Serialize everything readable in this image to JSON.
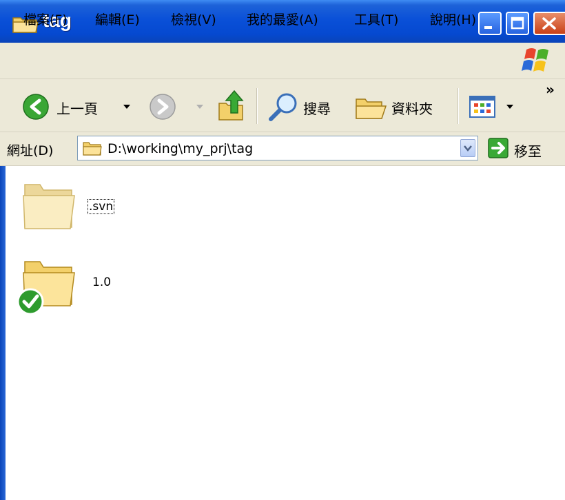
{
  "window": {
    "title": "tag"
  },
  "menu": [
    "檔案(F)",
    "編輯(E)",
    "檢視(V)",
    "我的最愛(A)",
    "工具(T)",
    "說明(H)"
  ],
  "toolbar": {
    "back_label": "上一頁",
    "search_label": "搜尋",
    "folders_label": "資料夾",
    "more": "»"
  },
  "address": {
    "label": "網址(D)",
    "value": "D:\\working\\my_prj\\tag",
    "go_label": "移至"
  },
  "items": [
    {
      "name": ".svn",
      "icon": "folder-icon",
      "selected": true
    },
    {
      "name": "1.0",
      "icon": "folder-ok-icon",
      "selected": false
    }
  ],
  "colors": {
    "titlebar": "#0a50d8",
    "chrome": "#ece9d8",
    "folder": "#f6d56b",
    "ok_badge": "#2e9b2e"
  }
}
